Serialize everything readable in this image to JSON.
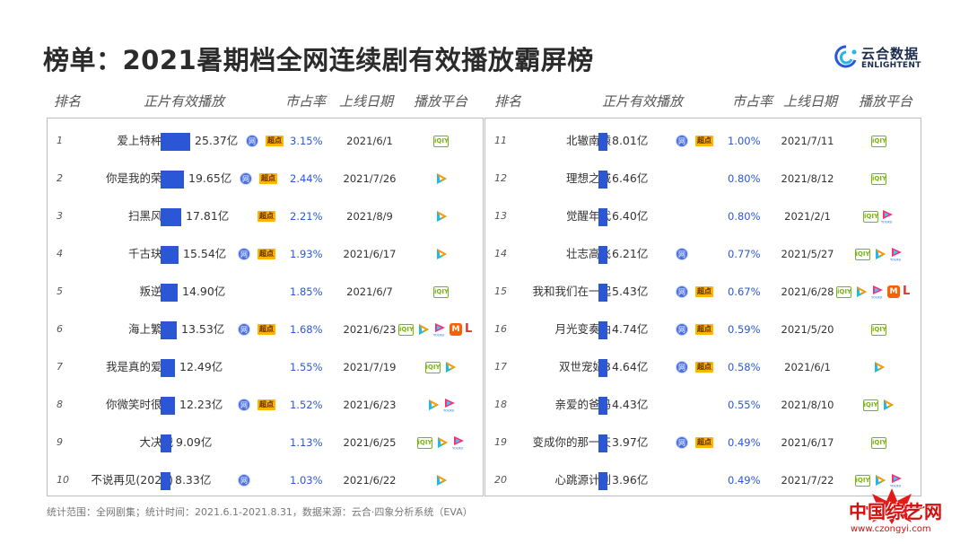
{
  "title": "榜单：2021暑期档全网连续剧有效播放霸屏榜",
  "logo": {
    "cn": "云合数据",
    "en": "ENLIGHTENT"
  },
  "headers": {
    "rank": "排名",
    "play": "正片有效播放",
    "share": "市占率",
    "date": "上线日期",
    "platform": "播放平台"
  },
  "badges": {
    "wang": "网",
    "chao": "超点"
  },
  "footnote": "统计范围：全网剧集；统计时间：2021.6.1-2021.8.31，数据来源：云合·四象分析系统（EVA）",
  "watermark": {
    "cn": "中国综艺网",
    "url": "www.czongyi.com"
  },
  "colors": {
    "bar": "#2b57d6",
    "share_text": "#2b57d6",
    "chao_badge": "#ffb400",
    "wang_badge": "#4a6fe0"
  },
  "chart_data": {
    "type": "bar",
    "value_unit": "亿",
    "left": [
      {
        "rank": "1",
        "name": "爱上特种兵",
        "value": 25.37,
        "label": "25.37亿",
        "wang": true,
        "chao": true,
        "share": "3.15%",
        "date": "2021/6/1",
        "platforms": [
          "iqiyi"
        ]
      },
      {
        "rank": "2",
        "name": "你是我的荣耀",
        "value": 19.65,
        "label": "19.65亿",
        "wang": true,
        "chao": true,
        "share": "2.44%",
        "date": "2021/7/26",
        "platforms": [
          "tencent"
        ]
      },
      {
        "rank": "3",
        "name": "扫黑风暴",
        "value": 17.81,
        "label": "17.81亿",
        "wang": false,
        "chao": true,
        "share": "2.21%",
        "date": "2021/8/9",
        "platforms": [
          "tencent"
        ]
      },
      {
        "rank": "4",
        "name": "千古玦尘",
        "value": 15.54,
        "label": "15.54亿",
        "wang": true,
        "chao": true,
        "share": "1.93%",
        "date": "2021/6/17",
        "platforms": [
          "tencent"
        ]
      },
      {
        "rank": "5",
        "name": "叛逆者",
        "value": 14.9,
        "label": "14.90亿",
        "wang": false,
        "chao": false,
        "share": "1.85%",
        "date": "2021/6/7",
        "platforms": [
          "iqiyi"
        ]
      },
      {
        "rank": "6",
        "name": "海上繁花",
        "value": 13.53,
        "label": "13.53亿",
        "wang": true,
        "chao": true,
        "share": "1.68%",
        "date": "2021/6/23",
        "platforms": [
          "iqiyi",
          "tencent",
          "youku",
          "mango",
          "le"
        ]
      },
      {
        "rank": "7",
        "name": "我是真的爱你",
        "value": 12.49,
        "label": "12.49亿",
        "wang": false,
        "chao": false,
        "share": "1.55%",
        "date": "2021/7/19",
        "platforms": [
          "iqiyi",
          "tencent"
        ]
      },
      {
        "rank": "8",
        "name": "你微笑时很美",
        "value": 12.23,
        "label": "12.23亿",
        "wang": true,
        "chao": true,
        "share": "1.52%",
        "date": "2021/6/23",
        "platforms": [
          "tencent",
          "youku"
        ]
      },
      {
        "rank": "9",
        "name": "大决战",
        "value": 9.09,
        "label": "9.09亿",
        "wang": false,
        "chao": false,
        "share": "1.13%",
        "date": "2021/6/25",
        "platforms": [
          "iqiyi",
          "tencent",
          "youku"
        ]
      },
      {
        "rank": "10",
        "name": "不说再见(2021)",
        "value": 8.33,
        "label": "8.33亿",
        "wang": true,
        "chao": false,
        "share": "1.03%",
        "date": "2021/6/22",
        "platforms": [
          "tencent"
        ]
      }
    ],
    "right": [
      {
        "rank": "11",
        "name": "北辙南辕",
        "value": 8.01,
        "label": "8.01亿",
        "wang": true,
        "chao": true,
        "share": "1.00%",
        "date": "2021/7/11",
        "platforms": [
          "iqiyi"
        ]
      },
      {
        "rank": "12",
        "name": "理想之城",
        "value": 6.46,
        "label": "6.46亿",
        "wang": false,
        "chao": false,
        "share": "0.80%",
        "date": "2021/8/12",
        "platforms": [
          "iqiyi"
        ]
      },
      {
        "rank": "13",
        "name": "觉醒年代",
        "value": 6.4,
        "label": "6.40亿",
        "wang": false,
        "chao": false,
        "share": "0.80%",
        "date": "2021/2/1",
        "platforms": [
          "iqiyi",
          "youku"
        ]
      },
      {
        "rank": "14",
        "name": "壮志高飞",
        "value": 6.21,
        "label": "6.21亿",
        "wang": true,
        "chao": false,
        "share": "0.77%",
        "date": "2021/5/27",
        "platforms": [
          "iqiyi",
          "tencent",
          "youku"
        ]
      },
      {
        "rank": "15",
        "name": "我和我们在一起",
        "value": 5.43,
        "label": "5.43亿",
        "wang": true,
        "chao": true,
        "share": "0.67%",
        "date": "2021/6/28",
        "platforms": [
          "iqiyi",
          "tencent",
          "youku",
          "mango",
          "le"
        ]
      },
      {
        "rank": "16",
        "name": "月光变奏曲",
        "value": 4.74,
        "label": "4.74亿",
        "wang": true,
        "chao": true,
        "share": "0.59%",
        "date": "2021/5/20",
        "platforms": [
          "iqiyi"
        ]
      },
      {
        "rank": "17",
        "name": "双世宠妃3",
        "value": 4.64,
        "label": "4.64亿",
        "wang": true,
        "chao": true,
        "share": "0.58%",
        "date": "2021/6/1",
        "platforms": [
          "tencent"
        ]
      },
      {
        "rank": "18",
        "name": "亲爱的爸妈",
        "value": 4.43,
        "label": "4.43亿",
        "wang": false,
        "chao": false,
        "share": "0.55%",
        "date": "2021/8/10",
        "platforms": [
          "iqiyi",
          "tencent"
        ]
      },
      {
        "rank": "19",
        "name": "变成你的那一天",
        "value": 3.97,
        "label": "3.97亿",
        "wang": true,
        "chao": true,
        "share": "0.49%",
        "date": "2021/6/17",
        "platforms": [
          "iqiyi"
        ]
      },
      {
        "rank": "20",
        "name": "心跳源计划",
        "value": 3.96,
        "label": "3.96亿",
        "wang": false,
        "chao": false,
        "share": "0.49%",
        "date": "2021/7/22",
        "platforms": [
          "iqiyi",
          "tencent",
          "youku"
        ]
      }
    ]
  }
}
